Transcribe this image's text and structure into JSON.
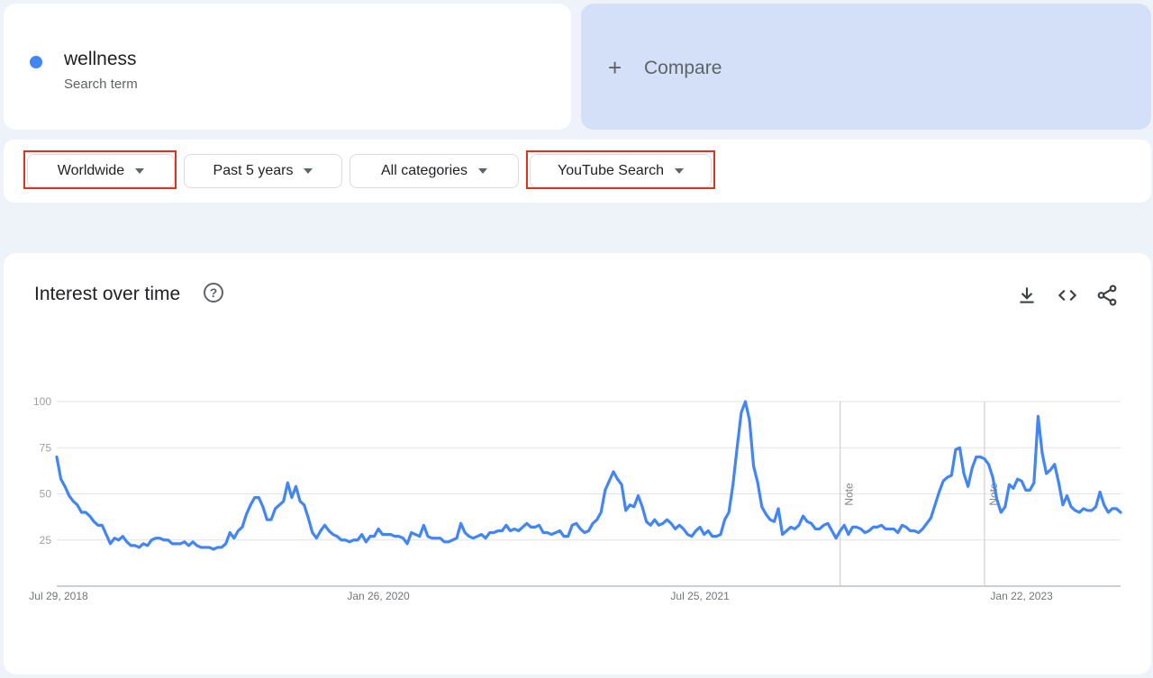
{
  "search_term": {
    "name": "wellness",
    "subtitle": "Search term",
    "color": "#4285f4"
  },
  "compare": {
    "plus": "+",
    "label": "Compare"
  },
  "filters": {
    "region": "Worldwide",
    "time": "Past 5 years",
    "category": "All categories",
    "property": "YouTube Search"
  },
  "chart_title": "Interest over time",
  "tools": {
    "download": "download-icon",
    "embed": "embed-code-icon",
    "share": "share-icon"
  },
  "chart_data": {
    "type": "line",
    "title": "Interest over time",
    "xlabel": "",
    "ylabel": "",
    "ylim": [
      0,
      100
    ],
    "yticks": [
      25,
      50,
      75,
      100
    ],
    "xtick_labels": [
      "Jul 29, 2018",
      "Jan 26, 2020",
      "Jul 25, 2021",
      "Jan 22, 2023"
    ],
    "notes": [
      "Note",
      "Note"
    ],
    "series": [
      {
        "name": "wellness",
        "color": "#4285f4",
        "values": [
          70,
          58,
          54,
          49,
          46,
          44,
          40,
          40,
          38,
          35,
          33,
          33,
          28,
          23,
          26,
          25,
          27,
          24,
          22,
          22,
          21,
          23,
          22,
          25,
          26,
          26,
          25,
          25,
          23,
          23,
          23,
          24,
          22,
          24,
          22,
          21,
          21,
          21,
          20,
          21,
          21,
          23,
          29,
          26,
          30,
          32,
          39,
          44,
          48,
          48,
          43,
          36,
          36,
          42,
          44,
          46,
          56,
          48,
          54,
          46,
          44,
          37,
          29,
          26,
          30,
          33,
          30,
          28,
          27,
          25,
          25,
          24,
          25,
          25,
          28,
          24,
          27,
          27,
          31,
          28,
          28,
          28,
          27,
          27,
          26,
          23,
          29,
          28,
          27,
          33,
          27,
          26,
          26,
          26,
          24,
          24,
          25,
          26,
          34,
          29,
          27,
          26,
          27,
          28,
          26,
          29,
          29,
          30,
          30,
          33,
          30,
          31,
          30,
          32,
          34,
          32,
          32,
          33,
          29,
          29,
          28,
          29,
          30,
          27,
          27,
          33,
          34,
          31,
          29,
          30,
          34,
          36,
          40,
          52,
          57,
          62,
          58,
          55,
          41,
          44,
          43,
          49,
          43,
          35,
          33,
          36,
          33,
          34,
          36,
          34,
          31,
          33,
          31,
          28,
          27,
          30,
          32,
          28,
          30,
          27,
          27,
          28,
          36,
          40,
          55,
          75,
          94,
          100,
          90,
          65,
          56,
          43,
          39,
          36,
          35,
          42,
          28,
          30,
          32,
          31,
          33,
          38,
          35,
          34,
          31,
          31,
          33,
          34,
          30,
          26,
          30,
          33,
          28,
          32,
          32,
          31,
          29,
          30,
          32,
          32,
          33,
          31,
          31,
          31,
          29,
          33,
          32,
          30,
          30,
          29,
          31,
          34,
          37,
          44,
          51,
          57,
          59,
          60,
          74,
          75,
          61,
          54,
          64,
          70,
          70,
          69,
          66,
          59,
          47,
          40,
          43,
          55,
          53,
          58,
          57,
          52,
          52,
          56,
          92,
          72,
          61,
          63,
          66,
          56,
          44,
          49,
          43,
          41,
          40,
          42,
          41,
          41,
          43,
          51,
          44,
          40,
          42,
          42,
          40
        ]
      }
    ]
  }
}
